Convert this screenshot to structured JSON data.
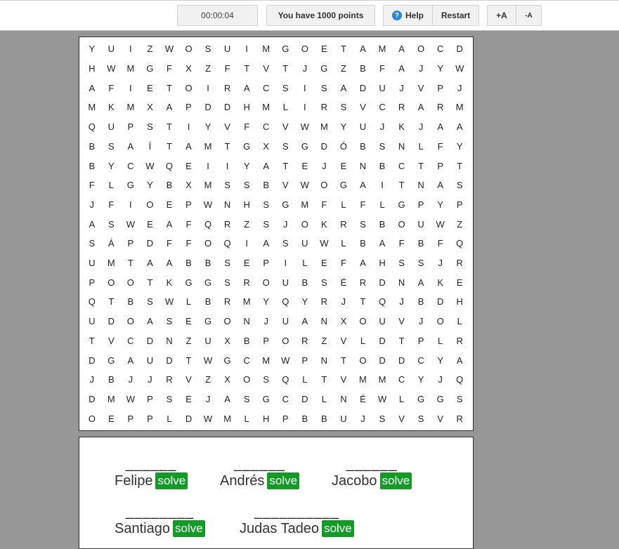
{
  "toolbar": {
    "timer": "00:00:04",
    "points_text": "You have 1000 points",
    "help_label": "Help",
    "help_icon": "?",
    "restart_label": "Restart",
    "font_increase_label": "+A",
    "font_decrease_label": "-A"
  },
  "grid_rows": [
    "YUIZWOSUIMGOETAMAOCD",
    "HWMGFXZFTVTJGZBFAJYW",
    "AFIETOIRACSISADUJVPJ",
    "MKMXAPDDHMLIRSVCRARM",
    "QUPSTIYVFCVWMYUJKJAA",
    "BSAÍTAMTGXSGDÓBSNLFY",
    "BYCWQEIIYATEJENBCTPT",
    "FLGYBXMSSBVWOGAITNAS",
    "JFIOEPWNHSGMFLFLGPYP",
    "ASWEAFQRZSJOKRSBOUWZ",
    "SÁPDFFOQIASUWLBAFBFQ",
    "UMTAABBSEPILEFAHSSJR",
    "POOTKGGSROUBSÉRDNAKE",
    "QTBSWLBRMYQYRJTQJBDH",
    "UDOASEGONJUANXOUVJOL",
    "TVCDNZUXBPORZVLDTPLR",
    "DGAUDTWGCMWPNTODDCYA",
    "JBJJRVZXOSQLTVMMCYJQ",
    "DMWPSEJASGCDLNÉWLGGS",
    "OEPPLDWMLHPBBUJSVSVR"
  ],
  "words": [
    {
      "blanks": "______",
      "name": "Felipe",
      "solve": "solve"
    },
    {
      "blanks": "______",
      "name": "Andrés",
      "solve": "solve"
    },
    {
      "blanks": "______",
      "name": "Jacobo",
      "solve": "solve"
    },
    {
      "blanks": "________",
      "name": "Santiago",
      "solve": "solve"
    },
    {
      "blanks": "__________",
      "name": "Judas Tadeo",
      "solve": "solve"
    }
  ]
}
